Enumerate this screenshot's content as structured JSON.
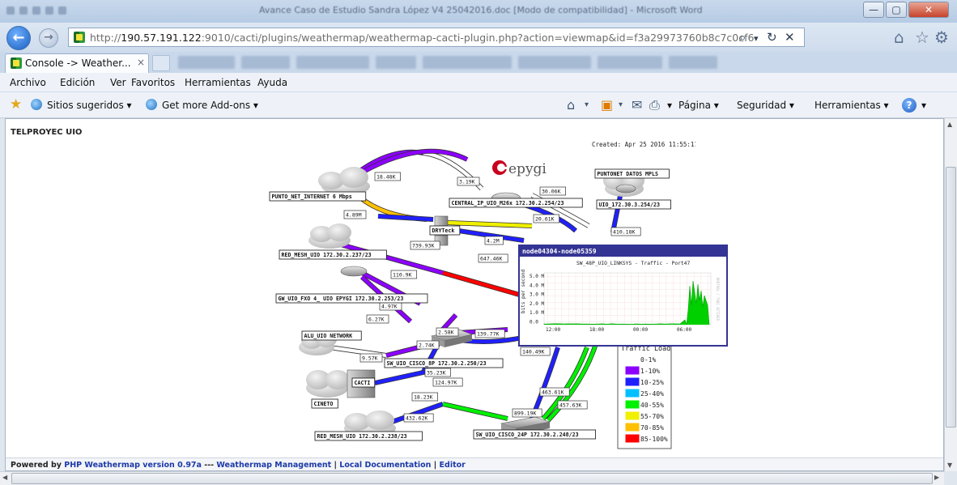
{
  "browser": {
    "window_title": "Avance Caso de Estudio Sandra López V4 25042016.doc [Modo de compatibilidad] - Microsoft Word",
    "url_prefix": "http://",
    "url_host": "190.57.191.122",
    "url_rest": ":9010/cacti/plugins/weathermap/weathermap-cacti-plugin.php?action=viewmap&id=f3a29973760b8c7c0cf6",
    "address_controls": [
      "search-icon",
      "refresh-icon",
      "stop-icon"
    ],
    "toolbar_icons": [
      "home-icon",
      "favorites-star-icon",
      "settings-gear-icon"
    ],
    "tab_label": "Console -> Weather...",
    "tab_close": "×",
    "menu": [
      "Archivo",
      "Edición",
      "Ver",
      "Favoritos",
      "Herramientas",
      "Ayuda"
    ],
    "favorites": {
      "suggested": "Sitios sugeridos ▾",
      "addons": "Get more Add-ons ▾"
    },
    "commandbar": {
      "page": "Página ▾",
      "security": "Seguridad ▾",
      "tools": "Herramientas ▾",
      "help": "?"
    }
  },
  "page": {
    "map_name": "TELPROYEC UIO",
    "created": "Created: Apr 25 2016 11:55:11",
    "footer": {
      "powered_by": "Powered by",
      "weathermap_link": "PHP Weathermap version 0.97a",
      "sep1": " --- ",
      "management_link": "Weathermap Management",
      "docs_link": "Local Documentation",
      "editor_link": "Editor",
      "pipe": " | "
    }
  },
  "map": {
    "logo_text": "epygi",
    "nodes": [
      {
        "id": "punto_net",
        "label": "PUNTO_NET_INTERNET 6 Mbps",
        "kind": "cloud"
      },
      {
        "id": "central_ip",
        "label": "CENTRAL_IP_UIO_M26x 172.30.2.254/23",
        "kind": "router"
      },
      {
        "id": "puntonet_datos",
        "label": "PUNTONET DATOS MPLS",
        "kind": "cloud"
      },
      {
        "id": "uio_253",
        "label": "UIO_172.30.3.254/23",
        "kind": "router"
      },
      {
        "id": "drytek",
        "label": "DRYTeck",
        "kind": "firewall"
      },
      {
        "id": "red_mesh_237",
        "label": "RED_MESH_UIO 172.30.2.237/23",
        "kind": "cloud"
      },
      {
        "id": "gw_uio",
        "label": "GW_UIO_FXO 4_ UIO  EPYGI 172.30.2.253/23",
        "kind": "router"
      },
      {
        "id": "alu_uio",
        "label": "ALU_UIO NETWORK",
        "kind": "cloud"
      },
      {
        "id": "sw_cisco_8p",
        "label": "SW_UIO_CISCO_8P 172.30.2.250/23",
        "kind": "switch"
      },
      {
        "id": "cineto",
        "label": "CINETO",
        "kind": "cloud"
      },
      {
        "id": "cacti",
        "label": "CACTI",
        "kind": "server"
      },
      {
        "id": "red_mesh_238",
        "label": "RED_MESH_UIO 172.30.2.238/23",
        "kind": "cloud"
      },
      {
        "id": "sw_cisco_24p",
        "label": "SW_UIO_CISCO_24P 172.30.2.248/23",
        "kind": "switch"
      }
    ],
    "link_labels": [
      "18.48K",
      "3.19K",
      "30.06K",
      "20.61K",
      "410.18K",
      "4.89M",
      "739.93K",
      "4.2M",
      "647.46K",
      "110.9K",
      "4.97K",
      "6.27K",
      "2.58K",
      "139.77K",
      "2.74K",
      "140.49K",
      "9.57K",
      "35.23K",
      "124.97K",
      "18.23K",
      "463.61K",
      "457.63K",
      "432.62K",
      "899.19K"
    ],
    "popup": {
      "header": "node04304-node05359",
      "graph_title": "SW_48P_UIO_LINKSYS - Traffic - Port47",
      "y_axis_label": "bits per second",
      "y_ticks": [
        "5.0 M",
        "4.0 M",
        "3.0 M",
        "2.0 M",
        "1.0 M",
        "0.0"
      ],
      "x_ticks": [
        "12:00",
        "18:00",
        "00:00",
        "06:00"
      ],
      "side_text": "RRDTOOL / TOBI OETIKER"
    },
    "legend": {
      "title": "Traffic Load",
      "items": [
        {
          "label": "0-1%",
          "color": "#ffffff"
        },
        {
          "label": "1-10%",
          "color": "#8c00ff"
        },
        {
          "label": "10-25%",
          "color": "#2020ff"
        },
        {
          "label": "25-40%",
          "color": "#00c0ff"
        },
        {
          "label": "40-55%",
          "color": "#00f000"
        },
        {
          "label": "55-70%",
          "color": "#f0f000"
        },
        {
          "label": "70-85%",
          "color": "#ffc000"
        },
        {
          "label": "85-100%",
          "color": "#ff0000"
        }
      ]
    }
  }
}
